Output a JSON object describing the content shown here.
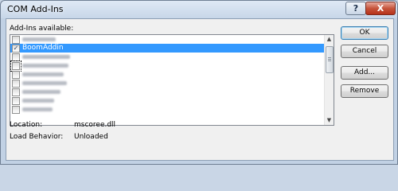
{
  "window": {
    "title": "COM Add-Ins",
    "help_glyph": "?",
    "close_glyph": "X"
  },
  "list": {
    "label": "Add-Ins available:",
    "items": [
      {
        "label": "",
        "checked": false,
        "blurred": true
      },
      {
        "label": "BoomAddin",
        "checked": true,
        "blurred": false,
        "selected": true
      },
      {
        "label": "",
        "checked": false,
        "blurred": true
      },
      {
        "label": "",
        "checked": false,
        "blurred": true,
        "focused": true
      },
      {
        "label": "",
        "checked": false,
        "blurred": true
      },
      {
        "label": "",
        "checked": false,
        "blurred": true
      },
      {
        "label": "",
        "checked": false,
        "blurred": true
      },
      {
        "label": "",
        "checked": false,
        "blurred": true
      },
      {
        "label": "",
        "checked": false,
        "blurred": true
      }
    ]
  },
  "buttons": {
    "ok": "OK",
    "cancel": "Cancel",
    "add": "Add...",
    "remove": "Remove"
  },
  "info": {
    "location_label": "Location:",
    "location_value": "mscoree.dll",
    "load_behavior_label": "Load Behavior:",
    "load_behavior_value": "Unloaded"
  }
}
